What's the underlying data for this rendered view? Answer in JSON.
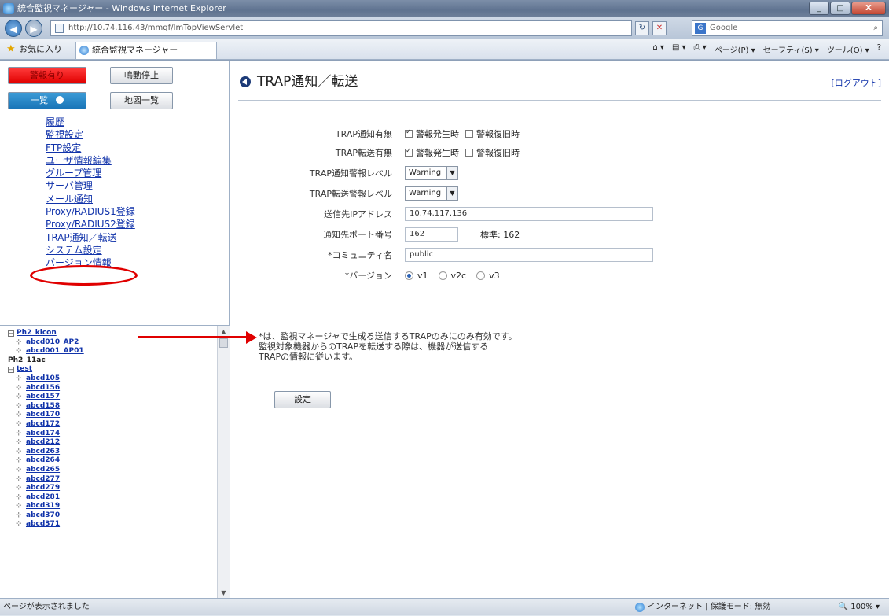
{
  "window": {
    "title": "統合監視マネージャー - Windows Internet Explorer",
    "buttons": {
      "minimize": "_",
      "maximize": "□",
      "close": "X"
    }
  },
  "browser": {
    "url": "http://10.74.116.43/mmgf/ImTopViewServlet",
    "search_placeholder": "Google",
    "favorites_label": "お気に入り",
    "tab_title": "統合監視マネージャー",
    "commands": [
      "ページ(P) ▾",
      "セーフティ(S) ▾",
      "ツール(O) ▾"
    ]
  },
  "left": {
    "alarm_button": "警報有り",
    "stop_button": "鳴動停止",
    "list_button": "一覧",
    "map_button": "地図一覧",
    "menu": [
      "履歴",
      "監視設定",
      "FTP設定",
      "ユーザ情報編集",
      "グループ管理",
      "サーバ管理",
      "メール通知",
      "Proxy/RADIUS1登録",
      "Proxy/RADIUS2登録",
      "TRAP通知／転送",
      "システム設定",
      "バージョン情報"
    ],
    "tree": [
      {
        "level": 0,
        "kind": "group",
        "label": "Ph2_kicon"
      },
      {
        "level": 1,
        "kind": "ap",
        "label": "abcd010_AP2"
      },
      {
        "level": 1,
        "kind": "ap",
        "label": "abcd001_AP01"
      },
      {
        "level": 0,
        "kind": "plain",
        "label": "Ph2_11ac"
      },
      {
        "level": 0,
        "kind": "group",
        "label": "test"
      },
      {
        "level": 1,
        "kind": "ap",
        "label": "abcd105"
      },
      {
        "level": 1,
        "kind": "ap",
        "label": "abcd156"
      },
      {
        "level": 1,
        "kind": "ap",
        "label": "abcd157"
      },
      {
        "level": 1,
        "kind": "ap",
        "label": "abcd158"
      },
      {
        "level": 1,
        "kind": "ap",
        "label": "abcd170"
      },
      {
        "level": 1,
        "kind": "ap",
        "label": "abcd172"
      },
      {
        "level": 1,
        "kind": "ap",
        "label": "abcd174"
      },
      {
        "level": 1,
        "kind": "ap",
        "label": "abcd212"
      },
      {
        "level": 1,
        "kind": "ap",
        "label": "abcd263"
      },
      {
        "level": 1,
        "kind": "ap",
        "label": "abcd264"
      },
      {
        "level": 1,
        "kind": "ap",
        "label": "abcd265"
      },
      {
        "level": 1,
        "kind": "ap",
        "label": "abcd277"
      },
      {
        "level": 1,
        "kind": "ap",
        "label": "abcd279"
      },
      {
        "level": 1,
        "kind": "ap",
        "label": "abcd281"
      },
      {
        "level": 1,
        "kind": "ap",
        "label": "abcd319"
      },
      {
        "level": 1,
        "kind": "ap",
        "label": "abcd370"
      },
      {
        "level": 1,
        "kind": "ap",
        "label": "abcd371"
      }
    ]
  },
  "main": {
    "title": "TRAP通知／転送",
    "logout": "ログアウト",
    "labels": {
      "notify_enable": "TRAP通知有無",
      "forward_enable": "TRAP転送有無",
      "notify_level": "TRAP通知警報レベル",
      "forward_level": "TRAP転送警報レベル",
      "dest_ip": "送信先IPアドレス",
      "port": "通知先ポート番号",
      "community": "*コミュニティ名",
      "version": "*バージョン"
    },
    "checkbox_on_alarm": "警報発生時",
    "checkbox_on_recovery": "警報復旧時",
    "notify_level_value": "Warning",
    "forward_level_value": "Warning",
    "dest_ip_value": "10.74.117.136",
    "port_value": "162",
    "port_default": "標準: 162",
    "community_value": "public",
    "versions": [
      "v1",
      "v2c",
      "v3"
    ],
    "note_lines": [
      "*は、監視マネージャで生成る送信するTRAPのみにのみ有効です。",
      "監視対象機器からのTRAPを転送する際は、機器が送信する",
      "TRAPの情報に従います。"
    ],
    "submit": "設定"
  },
  "status": {
    "left": "ページが表示されました",
    "zone": "インターネット | 保護モード: 無効",
    "zoom": "100%"
  },
  "colors": {
    "alarm": "#ff0000",
    "list_button": "#1a75b8",
    "link": "#1133aa",
    "annotation": "#e00000"
  }
}
